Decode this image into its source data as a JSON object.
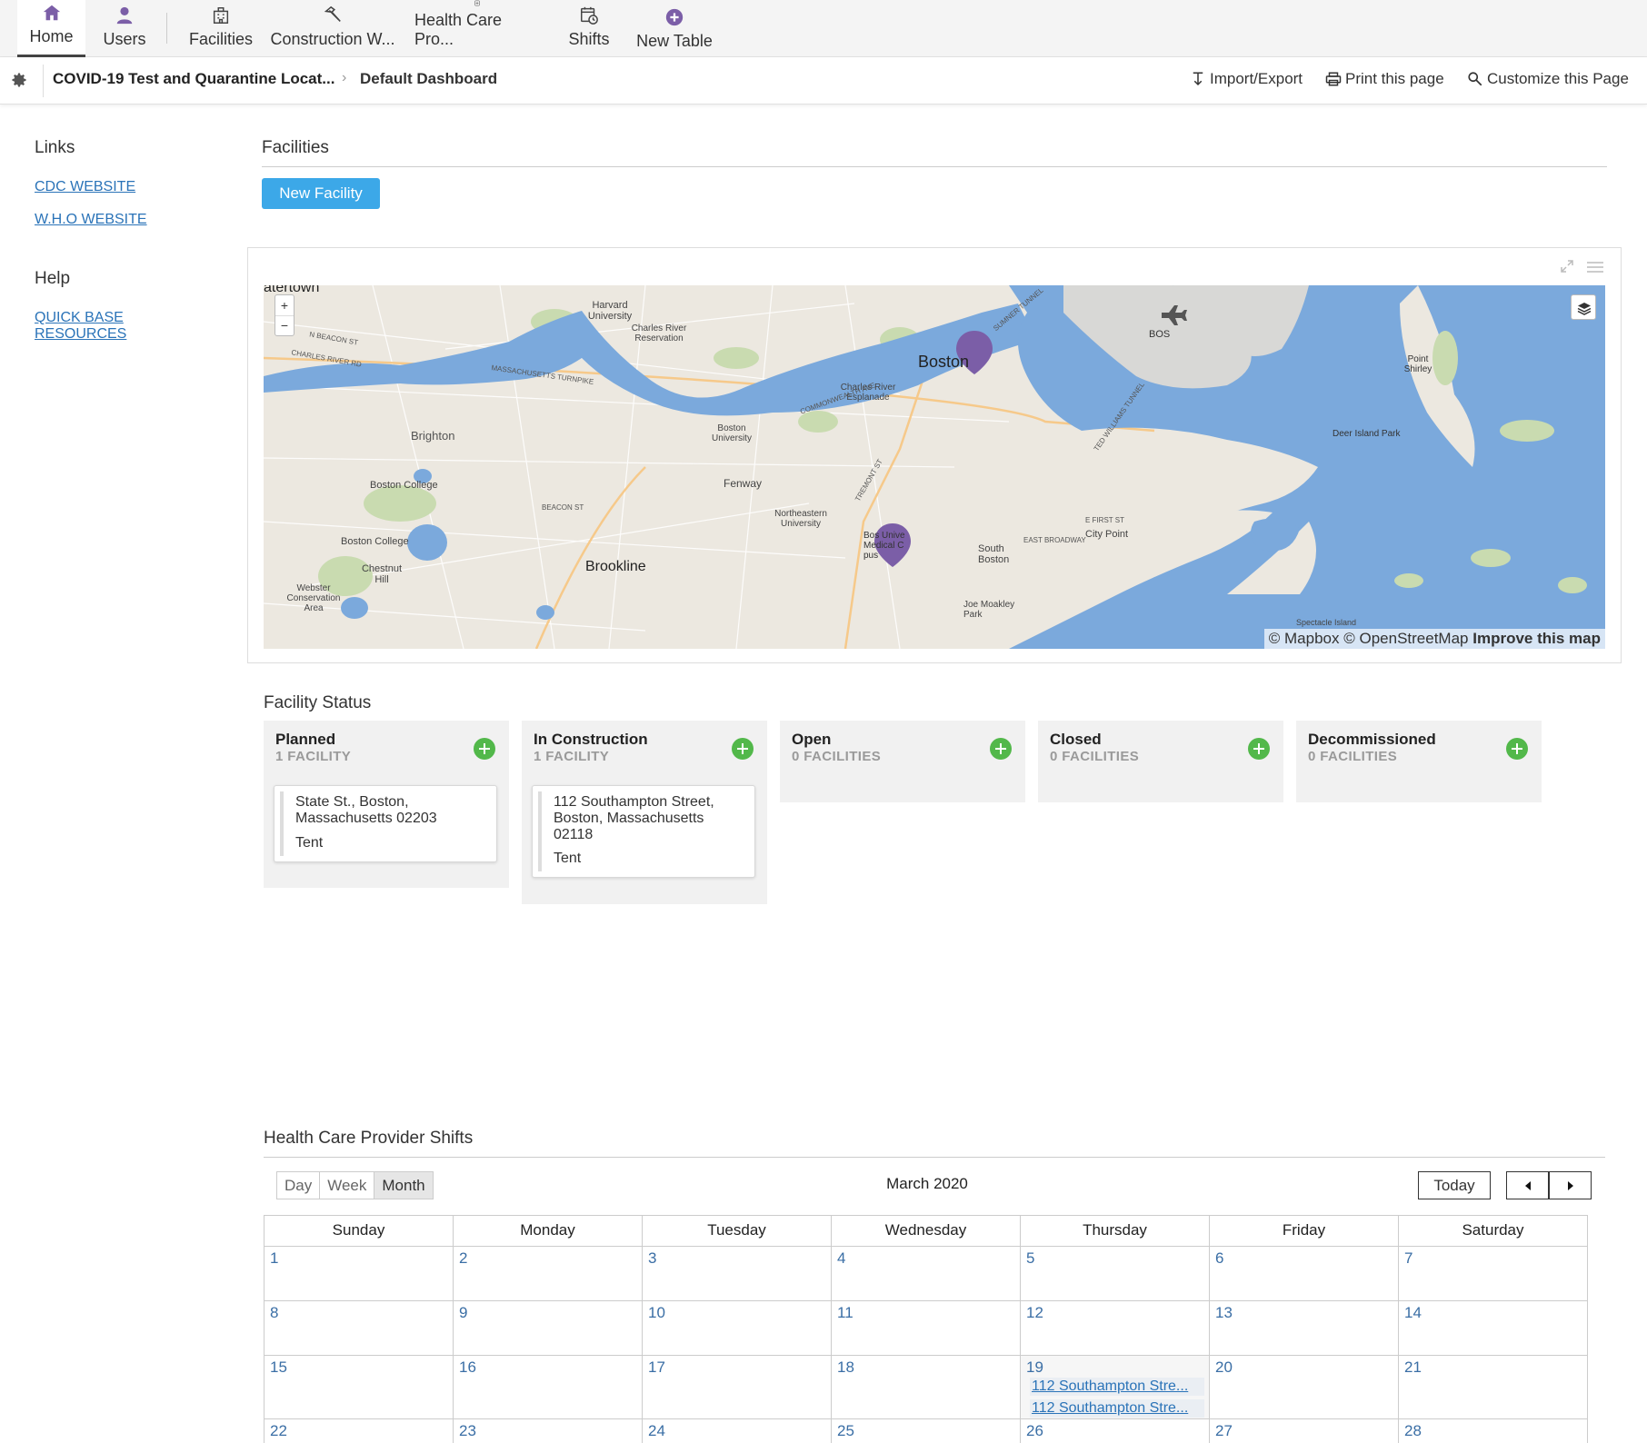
{
  "nav": {
    "tabs": [
      {
        "label": "Home",
        "icon": "home-icon"
      },
      {
        "label": "Users",
        "icon": "user-icon"
      },
      {
        "label": "Facilities",
        "icon": "building-icon"
      },
      {
        "label": "Construction W...",
        "icon": "hammer-icon"
      },
      {
        "label": "Health Care Pro...",
        "icon": "medical-plus-icon"
      },
      {
        "label": "Shifts",
        "icon": "calendar-clock-icon"
      },
      {
        "label": "New Table",
        "icon": "add-circle-icon"
      }
    ],
    "accent": "#7b5ea7"
  },
  "breadcrumb": {
    "app": "COVID-19 Test and Quarantine Locat...",
    "page": "Default Dashboard",
    "actions": [
      "Import/Export",
      "Print this page",
      "Customize this Page"
    ]
  },
  "sidebar": {
    "links_heading": "Links",
    "links": [
      "CDC WEBSITE",
      "W.H.O WEBSITE"
    ],
    "help_heading": "Help",
    "help_links": [
      "QUICK BASE",
      "RESOURCES"
    ]
  },
  "facilities": {
    "title": "Facilities",
    "new_button": "New Facility",
    "map": {
      "labels": [
        "Boston",
        "Brookline",
        "Brighton",
        "Boston College",
        "Fenway",
        "Harvard University",
        "Charles River Reservation",
        "Charles River Esplanade",
        "Boston University",
        "Northeastern University",
        "South Boston",
        "City Point",
        "Deer Island Park",
        "Point Shirley",
        "BOS",
        "Chestnut Hill",
        "Webster Conservation Area",
        "Joe Moakley Park",
        "Spectacle Island",
        "atertown",
        "Bos Unive Medical C pus"
      ],
      "road_labels": [
        "MASSACHUSETTS TURNPIKE",
        "COMMONWEALTH AVE",
        "BEACON ST",
        "TREMONT ST",
        "E FIRST ST",
        "EAST BROADWAY",
        "SUMNER TUNNEL",
        "TED WILLIAMS TUNNEL",
        "CHARLES RIVER RD",
        "N BEACON ST"
      ],
      "attribution_mapbox": "© Mapbox",
      "attribution_osm": "© OpenStreetMap",
      "attribution_improve": "Improve this map",
      "zoom_in": "+",
      "zoom_out": "−",
      "water_color": "#7ba9dc",
      "land_color": "#ece8e0",
      "marker_color": "#7b5ea7"
    }
  },
  "status": {
    "title": "Facility Status",
    "columns": [
      {
        "name": "Planned",
        "count": "1 FACILITY",
        "cards": [
          {
            "address": "State St., Boston, Massachusetts 02203",
            "type": "Tent"
          }
        ]
      },
      {
        "name": "In Construction",
        "count": "1 FACILITY",
        "cards": [
          {
            "address": "112 Southampton Street, Boston, Massachusetts 02118",
            "type": "Tent"
          }
        ]
      },
      {
        "name": "Open",
        "count": "0 FACILITIES",
        "cards": []
      },
      {
        "name": "Closed",
        "count": "0 FACILITIES",
        "cards": []
      },
      {
        "name": "Decommissioned",
        "count": "0 FACILITIES",
        "cards": []
      }
    ],
    "add_color": "#52b84a"
  },
  "shifts": {
    "title": "Health Care Provider Shifts",
    "views": [
      "Day",
      "Week",
      "Month"
    ],
    "active_view": "Month",
    "month": "March 2020",
    "today": "Today",
    "weekdays": [
      "Sunday",
      "Monday",
      "Tuesday",
      "Wednesday",
      "Thursday",
      "Friday",
      "Saturday"
    ],
    "weeks": [
      [
        "1",
        "2",
        "3",
        "4",
        "5",
        "6",
        "7"
      ],
      [
        "8",
        "9",
        "10",
        "11",
        "12",
        "13",
        "14"
      ],
      [
        "15",
        "16",
        "17",
        "18",
        "19",
        "20",
        "21"
      ],
      [
        "22",
        "23",
        "24",
        "25",
        "26",
        "27",
        "28"
      ]
    ],
    "events": [
      {
        "day": "19",
        "label": "112 Southampton Stre..."
      },
      {
        "day": "19",
        "label": "112 Southampton Stre..."
      }
    ]
  }
}
